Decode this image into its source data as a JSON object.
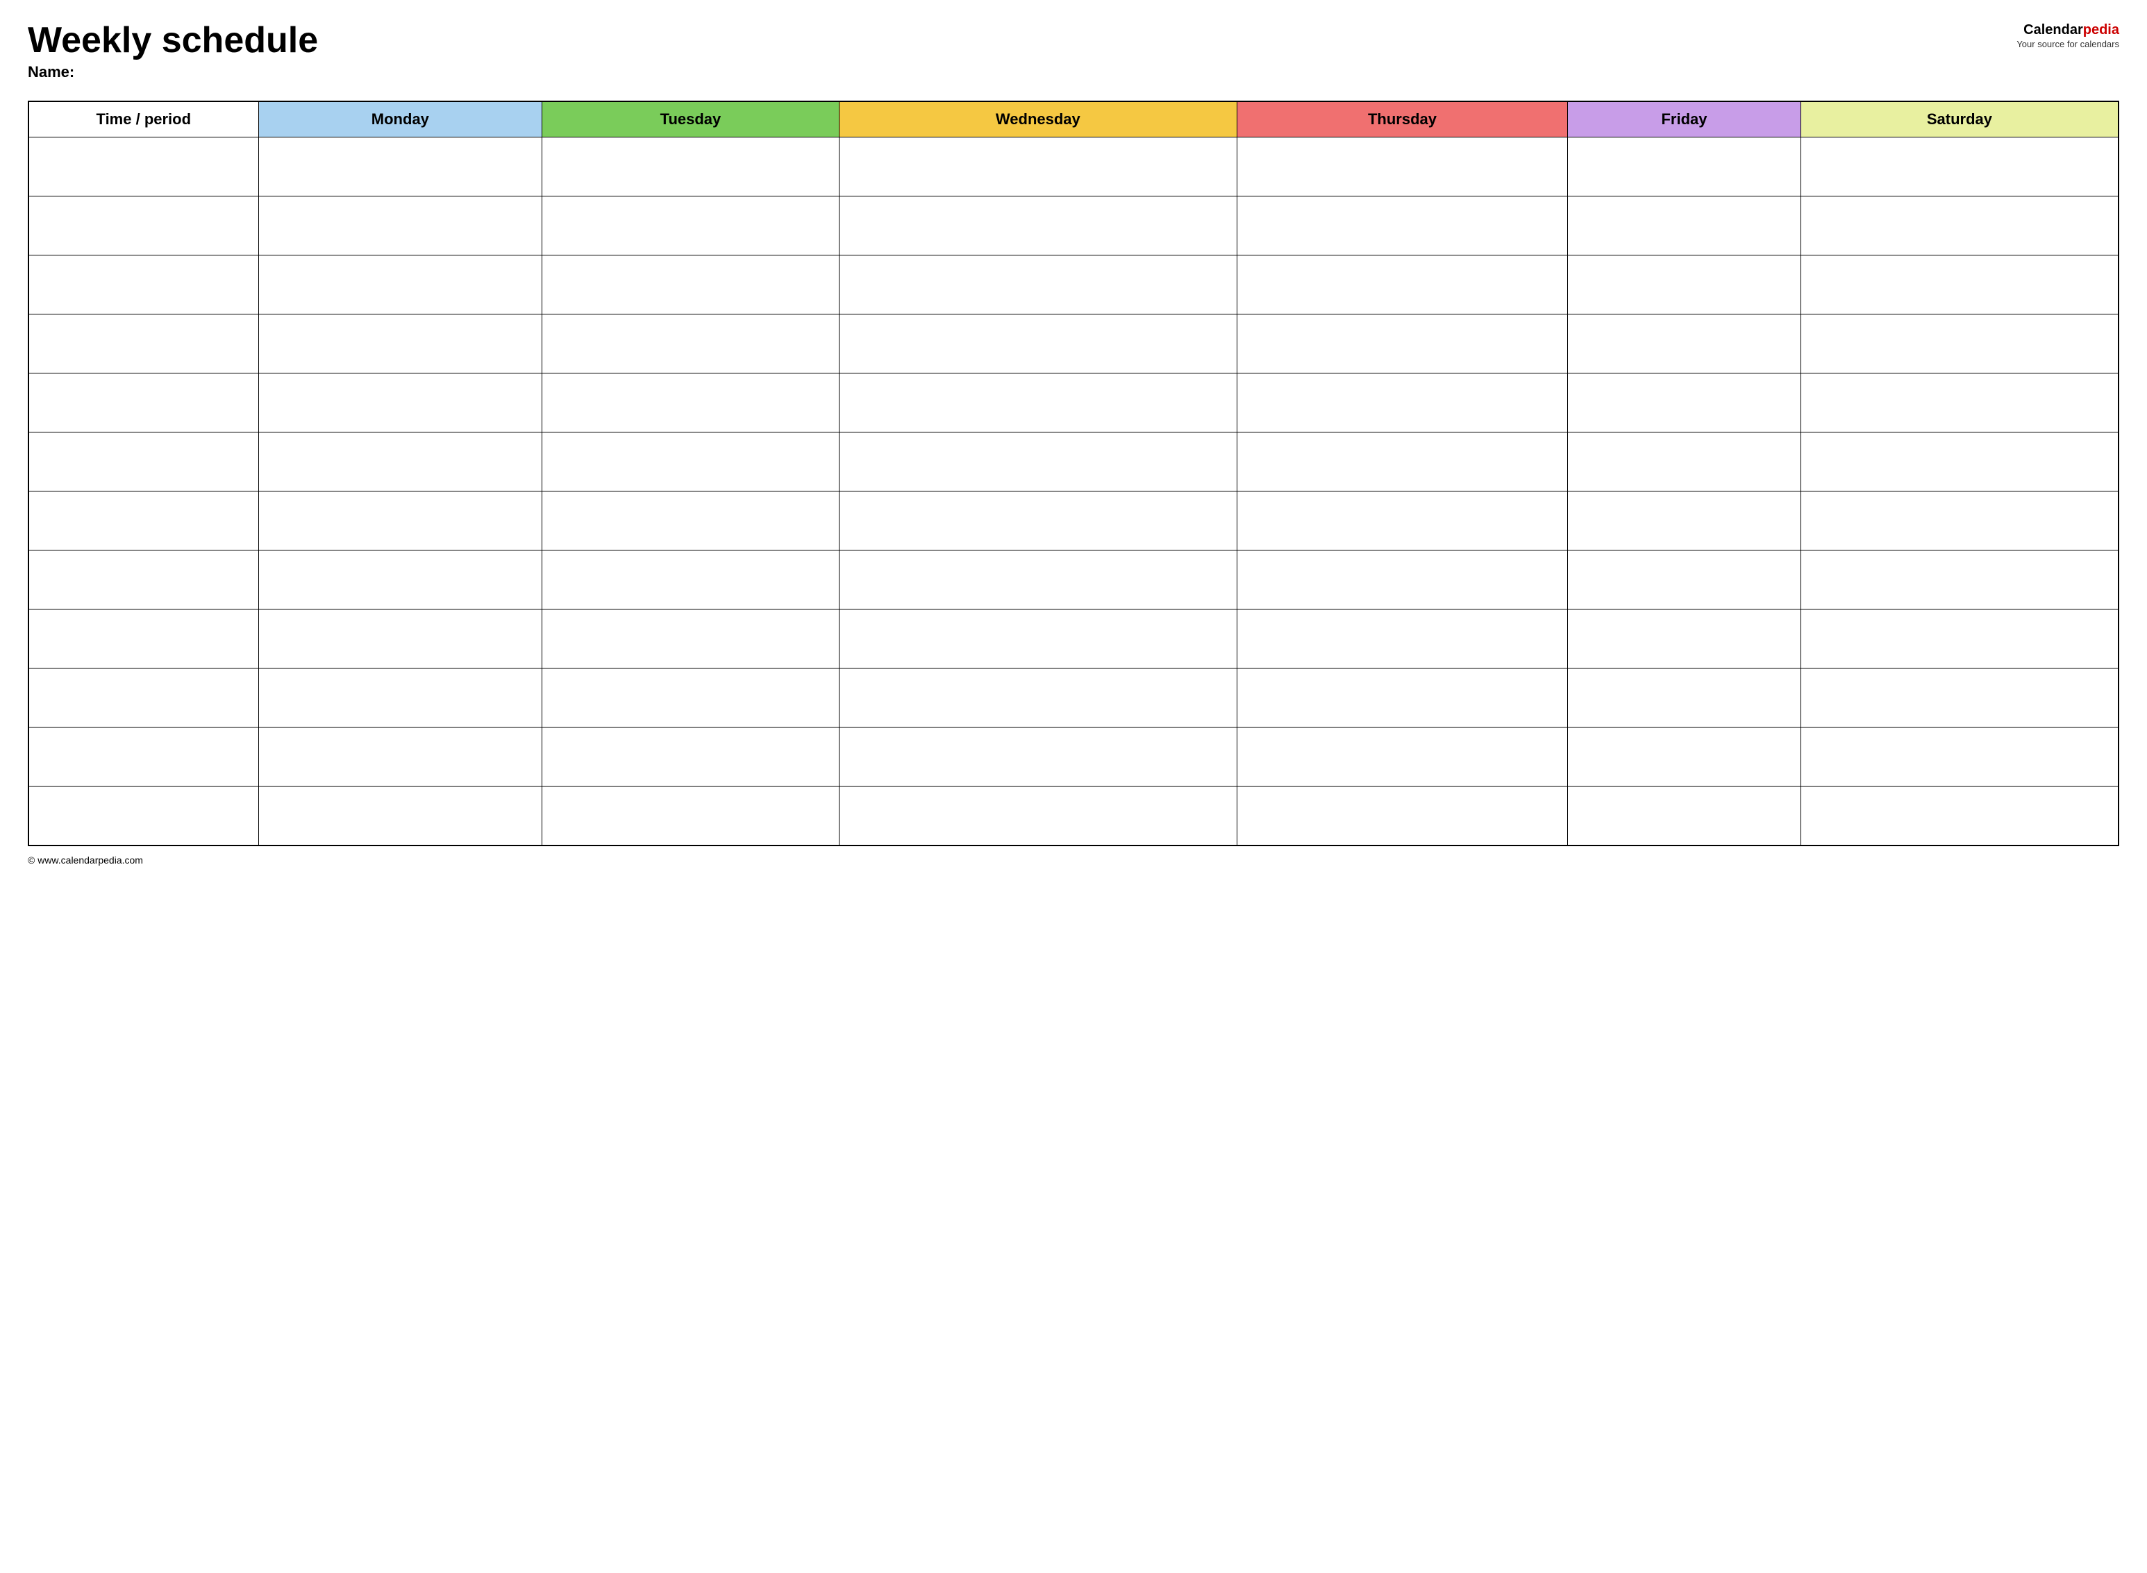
{
  "header": {
    "title": "Weekly schedule",
    "name_label": "Name:",
    "logo_text_calendar": "Calendar",
    "logo_text_pedia": "pedia",
    "logo_tagline": "Your source for calendars"
  },
  "table": {
    "columns": [
      {
        "id": "time",
        "label": "Time / period",
        "color": "#ffffff"
      },
      {
        "id": "monday",
        "label": "Monday",
        "color": "#a8d1f0"
      },
      {
        "id": "tuesday",
        "label": "Tuesday",
        "color": "#7acc5a"
      },
      {
        "id": "wednesday",
        "label": "Wednesday",
        "color": "#f5c842"
      },
      {
        "id": "thursday",
        "label": "Thursday",
        "color": "#f07070"
      },
      {
        "id": "friday",
        "label": "Friday",
        "color": "#c89de8"
      },
      {
        "id": "saturday",
        "label": "Saturday",
        "color": "#e8f0a0"
      }
    ],
    "rows": 12
  },
  "footer": {
    "url": "© www.calendarpedia.com"
  }
}
